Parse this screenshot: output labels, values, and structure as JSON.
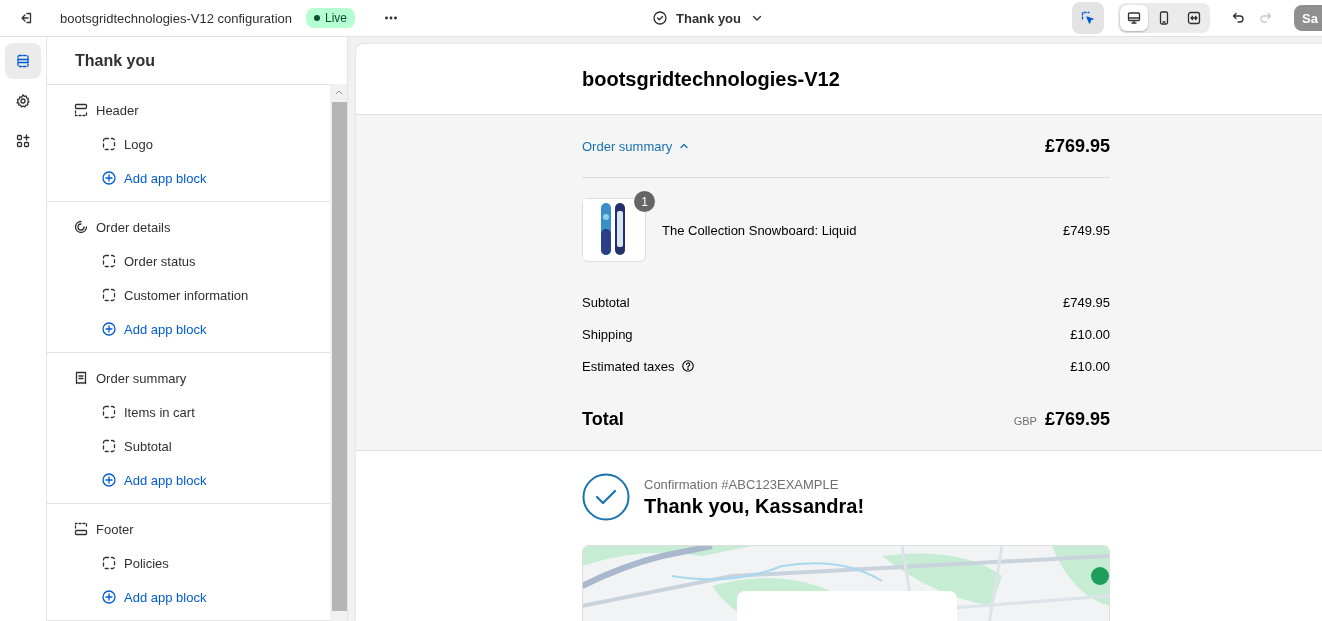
{
  "topbar": {
    "title": "bootsgridtechnologies-V12 configuration",
    "status": "Live",
    "page_selector": "Thank you",
    "inspector": {
      "on": true
    },
    "devices": [
      {
        "kind": "desktop",
        "selected": true
      },
      {
        "kind": "mobile",
        "selected": false
      },
      {
        "kind": "fullwidth",
        "selected": false
      }
    ],
    "undo": {
      "disabled": false
    },
    "redo": {
      "disabled": true
    },
    "save": {
      "label": "Sa",
      "disabled": true
    }
  },
  "rail": [
    {
      "kind": "sections",
      "selected": true
    },
    {
      "kind": "settings",
      "selected": false
    },
    {
      "kind": "apps",
      "selected": false
    }
  ],
  "sidebar": {
    "title": "Thank you",
    "sections": [
      {
        "kind": "header",
        "label": "Header",
        "items": [
          {
            "kind": "block",
            "label": "Logo"
          },
          {
            "kind": "add",
            "label": "Add app block"
          }
        ]
      },
      {
        "kind": "details",
        "label": "Order details",
        "items": [
          {
            "kind": "block",
            "label": "Order status"
          },
          {
            "kind": "block",
            "label": "Customer information"
          },
          {
            "kind": "add",
            "label": "Add app block"
          }
        ]
      },
      {
        "kind": "summary",
        "label": "Order summary",
        "items": [
          {
            "kind": "block",
            "label": "Items in cart"
          },
          {
            "kind": "block",
            "label": "Subtotal"
          },
          {
            "kind": "add",
            "label": "Add app block"
          }
        ]
      },
      {
        "kind": "footer",
        "label": "Footer",
        "items": [
          {
            "kind": "block",
            "label": "Policies"
          },
          {
            "kind": "add",
            "label": "Add app block"
          }
        ]
      }
    ]
  },
  "preview": {
    "shop_name": "bootsgridtechnologies-V12",
    "summary": {
      "toggle": "Order summary",
      "expanded": true,
      "total_top": "£769.95",
      "line_items": [
        {
          "quantity": "1",
          "title": "The Collection Snowboard: Liquid",
          "price": "£749.95"
        }
      ],
      "costs": [
        {
          "label": "Subtotal",
          "value": "£749.95",
          "info": false
        },
        {
          "label": "Shipping",
          "value": "£10.00",
          "info": false
        },
        {
          "label": "Estimated taxes",
          "value": "£10.00",
          "info": true
        }
      ],
      "total": {
        "label": "Total",
        "currency": "GBP",
        "value": "£769.95"
      }
    },
    "confirmation": {
      "number": "Confirmation #ABC123EXAMPLE",
      "heading": "Thank you, Kassandra!"
    }
  }
}
